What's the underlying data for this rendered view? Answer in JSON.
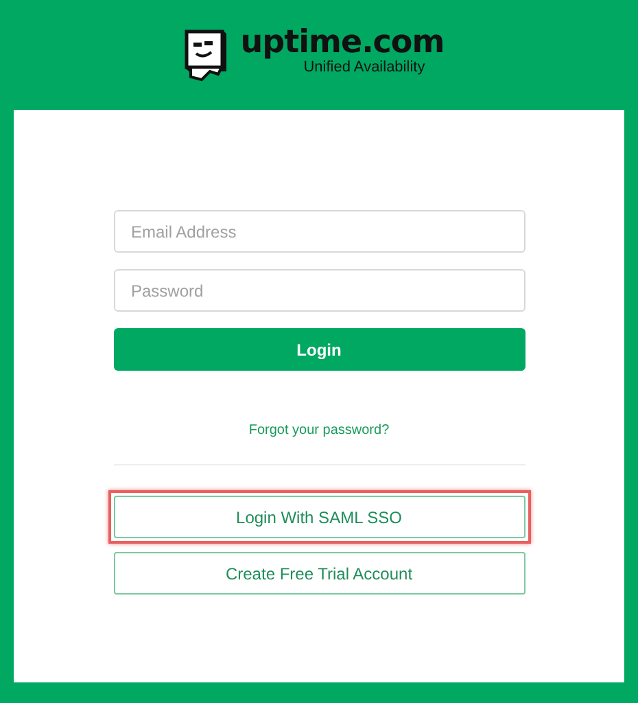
{
  "logo": {
    "brand": "uptime.com",
    "tagline": "Unified Availability"
  },
  "form": {
    "email": {
      "placeholder": "Email Address"
    },
    "password": {
      "placeholder": "Password"
    },
    "submit": "Login",
    "forgot_link": "Forgot your password?"
  },
  "buttons": [
    {
      "label": "Login With SAML SSO",
      "highlighted": true
    },
    {
      "label": "Create Free Trial Account",
      "highlighted": false
    }
  ]
}
